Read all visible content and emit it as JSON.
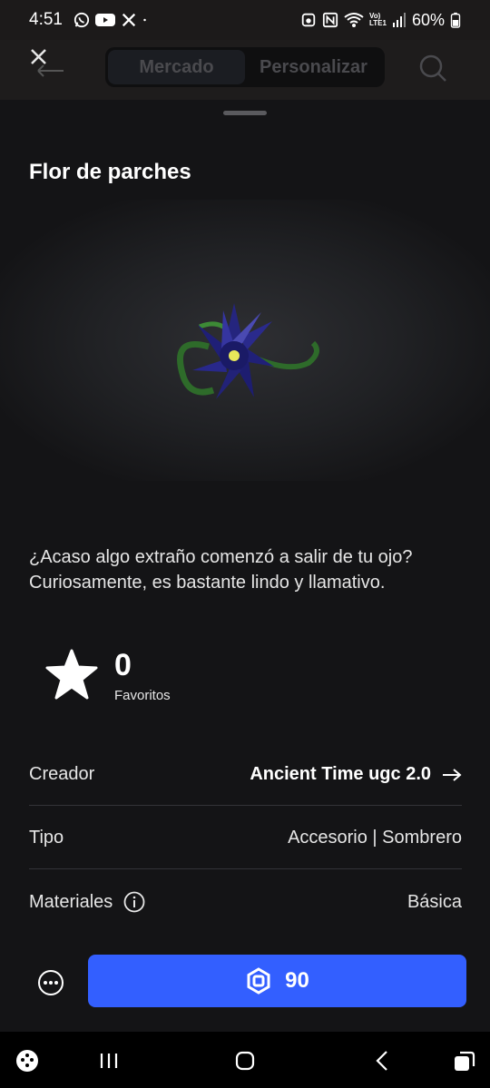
{
  "status_bar": {
    "time": "4:51",
    "battery": "60%",
    "left_icons": [
      "whatsapp-icon",
      "youtube-icon",
      "x-icon",
      "dot-icon"
    ],
    "right_icons": [
      "screenshot-icon",
      "nfc-icon",
      "wifi-icon",
      "volte-icon",
      "signal-icon",
      "battery-icon"
    ],
    "volte_label": "Vo)\nLTE1"
  },
  "header": {
    "tabs": [
      {
        "label": "Mercado"
      },
      {
        "label": "Personalizar"
      }
    ]
  },
  "item": {
    "title": "Flor de parches",
    "description": "¿Acaso algo extraño comenzó a salir de tu ojo? Curiosamente, es bastante lindo y llamativo.",
    "favorites_count": "0",
    "favorites_label": "Favoritos"
  },
  "details": {
    "creator_label": "Creador",
    "creator_value": "Ancient Time ugc 2.0",
    "type_label": "Tipo",
    "type_value": "Accesorio | Sombrero",
    "materials_label": "Materiales",
    "materials_value": "Básica"
  },
  "purchase": {
    "price": "90"
  },
  "colors": {
    "accent": "#335fff",
    "background": "#141416",
    "flower_petal": "#1e1e7a",
    "flower_stem": "#2e6b2a"
  }
}
